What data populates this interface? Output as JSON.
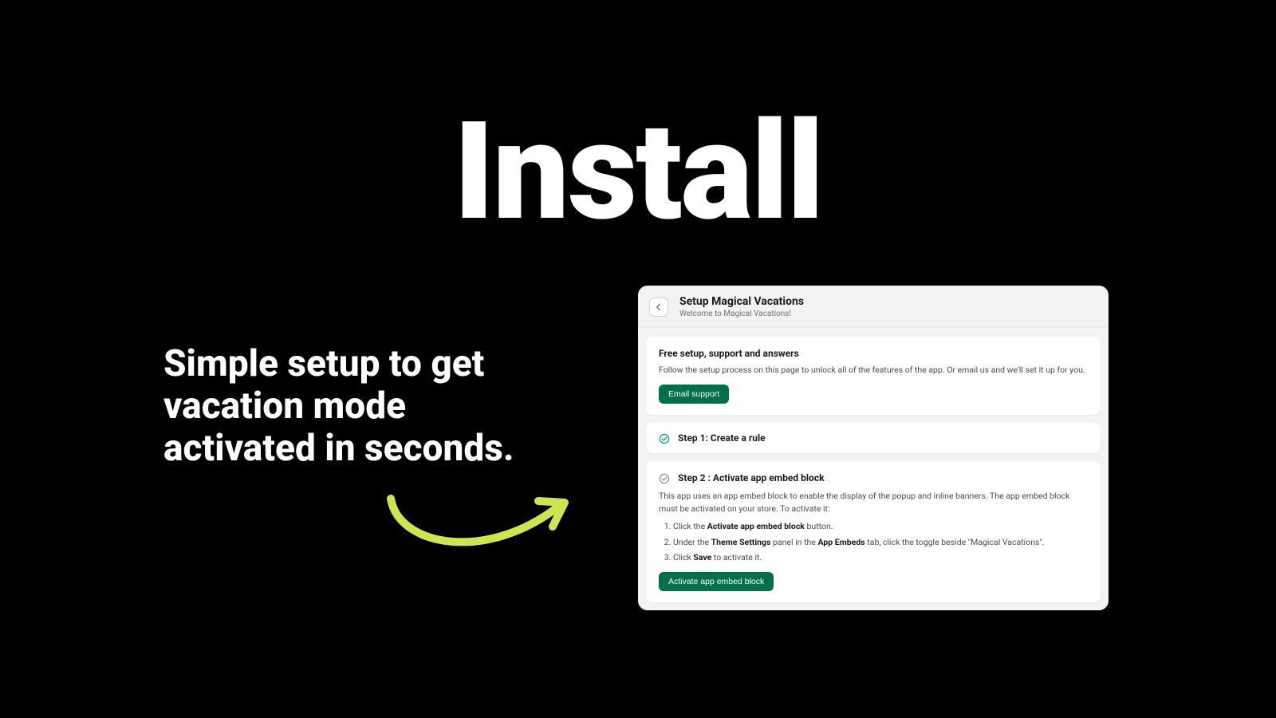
{
  "hero": {
    "title": "Install",
    "tagline": "Simple setup to get vacation mode activated in seconds."
  },
  "panel": {
    "header": {
      "title": "Setup Magical Vacations",
      "subtitle": "Welcome to Magical Vacations!"
    },
    "support_card": {
      "title": "Free setup, support and answers",
      "text": "Follow the setup process on this page to unlock all of the features of the app. Or email us and we'll set it up for you.",
      "button": "Email support"
    },
    "step1": {
      "title": "Step 1: Create a rule"
    },
    "step2": {
      "title": "Step 2 : Activate app embed block",
      "intro": "This app uses an app embed block to enable the display of the popup and inline banners. The app embed block must be activated on your store. To activate it:",
      "li1_a": "Click the ",
      "li1_b": "Activate app embed block",
      "li1_c": " button.",
      "li2_a": "Under the ",
      "li2_b": "Theme Settings",
      "li2_c": " panel in the ",
      "li2_d": "App Embeds",
      "li2_e": " tab, click the toggle beside \"Magical Vacations\".",
      "li3_a": "Click ",
      "li3_b": "Save",
      "li3_c": " to activate it.",
      "button": "Activate app embed block"
    }
  },
  "colors": {
    "accent_green": "#00704a",
    "arrow": "#cde550"
  }
}
